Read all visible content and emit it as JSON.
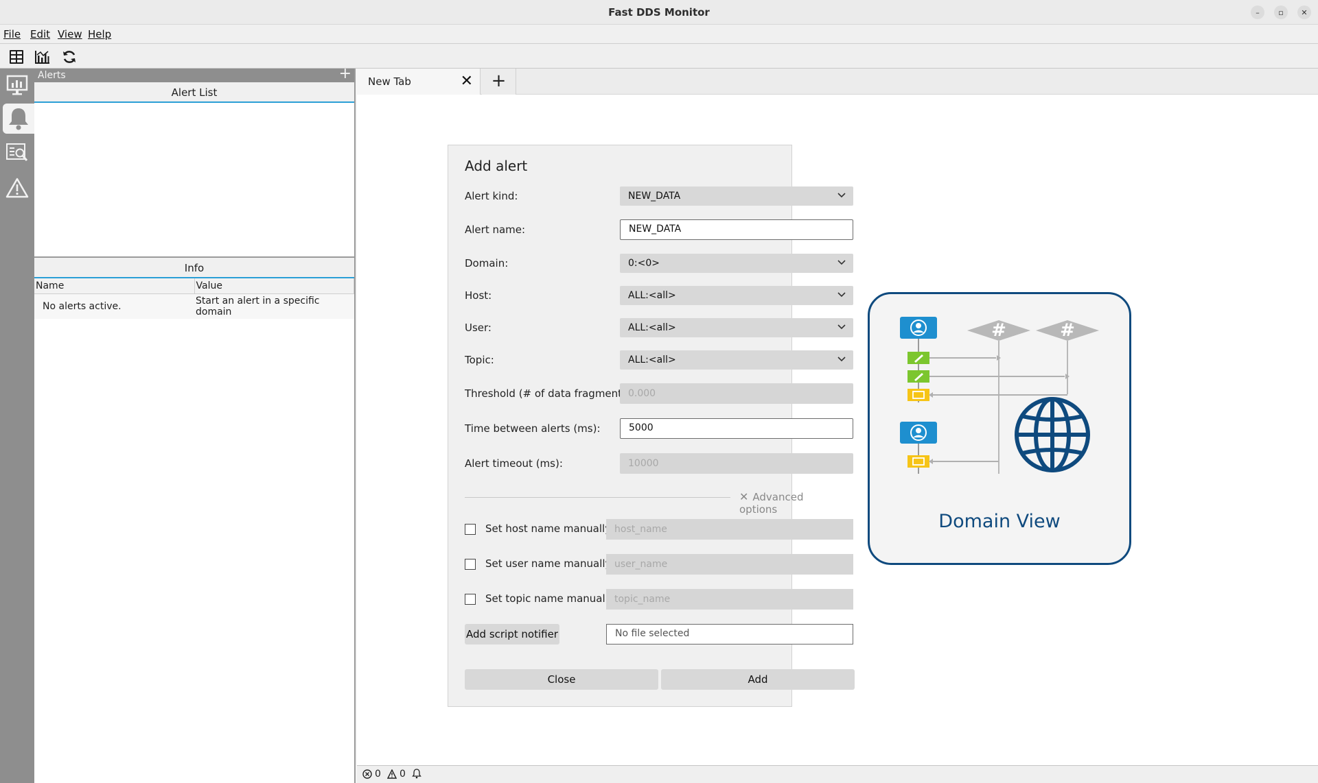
{
  "window": {
    "title": "Fast DDS Monitor",
    "minimize_glyph": "–",
    "maximize_glyph": "▫",
    "close_glyph": "✕"
  },
  "menu": {
    "file": "File",
    "edit": "Edit",
    "view": "View",
    "help": "Help"
  },
  "toolbar": {
    "icons": [
      "dashboard-icon",
      "chart-icon",
      "refresh-icon"
    ]
  },
  "sidebar_icons": [
    "monitor-icon",
    "bell-icon",
    "explorer-icon",
    "warning-icon"
  ],
  "alerts_panel": {
    "header": "Alerts",
    "add_glyph": "+",
    "alert_list_title": "Alert List",
    "info_title": "Info",
    "columns": [
      "Name",
      "Value"
    ],
    "rows": [
      [
        "No alerts active.",
        "Start an alert in a specific domain"
      ]
    ]
  },
  "tabs": {
    "items": [
      "New Tab"
    ],
    "close_glyph": "✕",
    "add_glyph": "+"
  },
  "dialog": {
    "title": "Add alert",
    "alert_kind_label": "Alert kind:",
    "alert_kind_value": "NEW_DATA",
    "alert_name_label": "Alert name:",
    "alert_name_value": "NEW_DATA",
    "domain_label": "Domain:",
    "domain_value": "0:<0>",
    "host_label": "Host:",
    "host_value": "ALL:<all>",
    "user_label": "User:",
    "user_value": "ALL:<all>",
    "topic_label": "Topic:",
    "topic_value": "ALL:<all>",
    "threshold_label": "Threshold (# of data fragments):",
    "threshold_value": "0.000",
    "time_between_label": "Time between alerts (ms):",
    "time_between_value": "5000",
    "timeout_label": "Alert timeout (ms):",
    "timeout_value": "10000",
    "advanced_options": "Advanced options",
    "set_host_label": "Set host name manually",
    "host_placeholder": "host_name",
    "set_user_label": "Set user name manually",
    "user_placeholder": "user_name",
    "set_topic_label": "Set topic name manually",
    "topic_placeholder": "topic_name",
    "script_button": "Add script notifier",
    "file_value": "No file selected",
    "close_button": "Close",
    "add_button": "Add"
  },
  "domain_view": {
    "label": "Domain View",
    "hash_glyph": "#"
  },
  "statusbar": {
    "errors": "0",
    "warnings": "0"
  },
  "colors": {
    "accent": "#2a9fd6",
    "brand": "#0f4a7e",
    "participant": "#1e8fcf",
    "writer": "#7cc62e",
    "reader": "#f6c417"
  }
}
